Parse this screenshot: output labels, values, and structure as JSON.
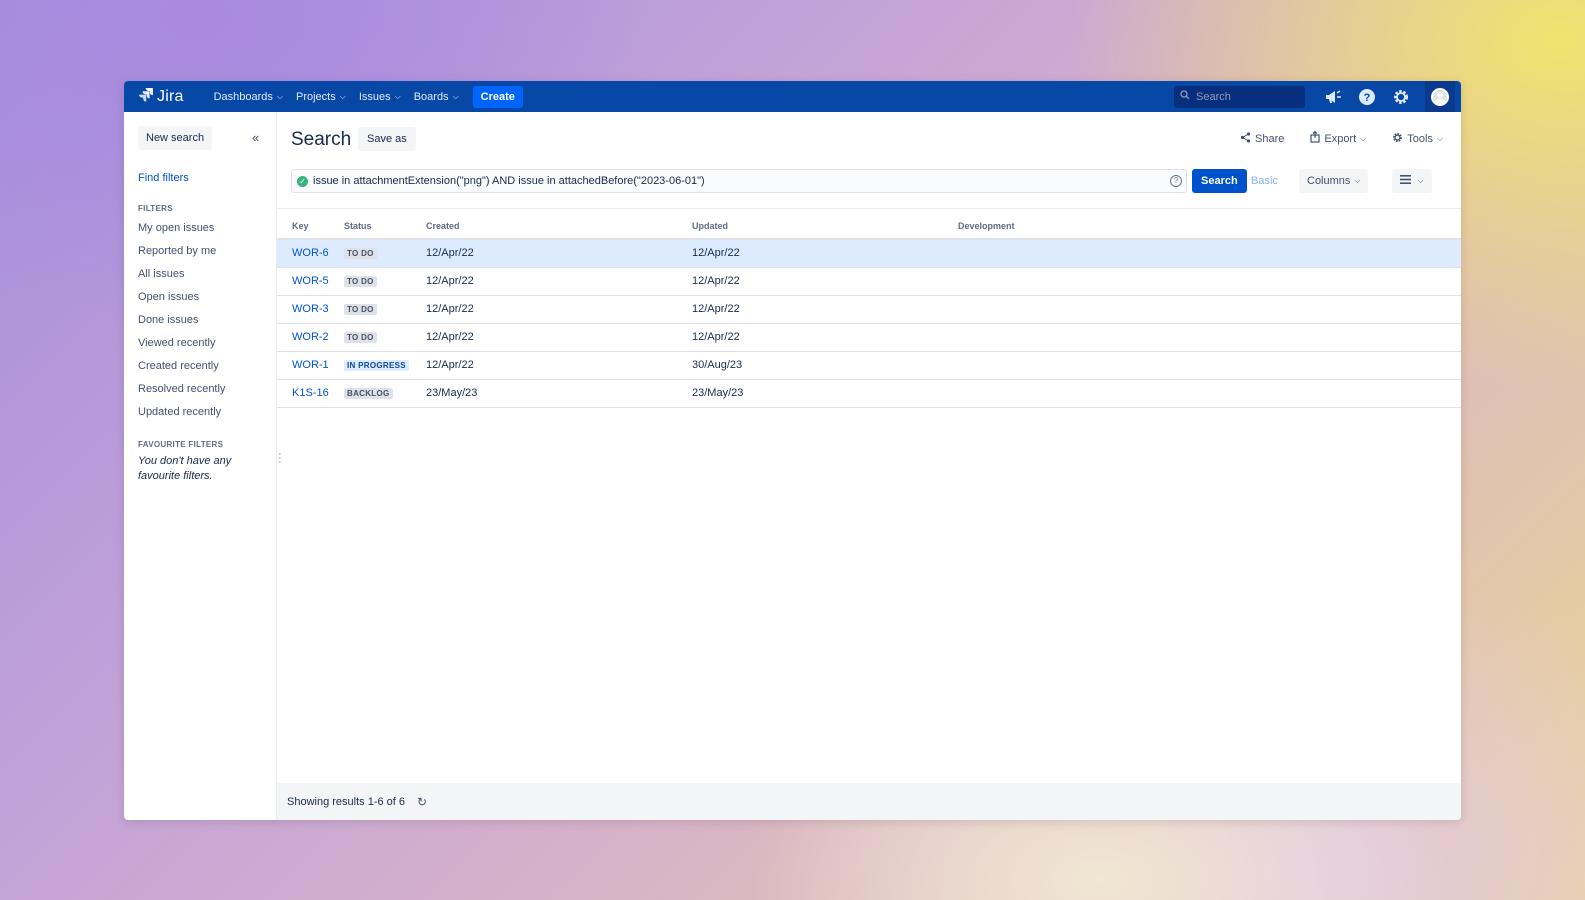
{
  "nav": {
    "logo": "Jira",
    "items": [
      {
        "label": "Dashboards"
      },
      {
        "label": "Projects"
      },
      {
        "label": "Issues"
      },
      {
        "label": "Boards"
      }
    ],
    "create_label": "Create",
    "search_placeholder": "Search"
  },
  "sidebar": {
    "new_search": "New search",
    "find_filters": "Find filters",
    "filters_title": "FILTERS",
    "filters": [
      "My open issues",
      "Reported by me",
      "All issues",
      "Open issues",
      "Done issues",
      "Viewed recently",
      "Created recently",
      "Resolved recently",
      "Updated recently"
    ],
    "favourite_title": "FAVOURITE FILTERS",
    "favourite_empty": "You don't have any favourite filters."
  },
  "header": {
    "title": "Search",
    "save_as": "Save as",
    "share": "Share",
    "export": "Export",
    "tools": "Tools"
  },
  "query": {
    "jql": "issue in attachmentExtension(\"png\") AND issue in attachedBefore(\"2023-06-01\")",
    "search_button": "Search",
    "basic_link": "Basic",
    "columns_button": "Columns"
  },
  "table": {
    "columns": [
      "Key",
      "Status",
      "Created",
      "Updated",
      "Development"
    ],
    "rows": [
      {
        "key": "WOR-6",
        "status": "TO DO",
        "created": "12/Apr/22",
        "updated": "12/Apr/22"
      },
      {
        "key": "WOR-5",
        "status": "TO DO",
        "created": "12/Apr/22",
        "updated": "12/Apr/22"
      },
      {
        "key": "WOR-3",
        "status": "TO DO",
        "created": "12/Apr/22",
        "updated": "12/Apr/22"
      },
      {
        "key": "WOR-2",
        "status": "TO DO",
        "created": "12/Apr/22",
        "updated": "12/Apr/22"
      },
      {
        "key": "WOR-1",
        "status": "IN PROGRESS",
        "created": "12/Apr/22",
        "updated": "30/Aug/23"
      },
      {
        "key": "K1S-16",
        "status": "BACKLOG",
        "created": "23/May/23",
        "updated": "23/May/23"
      }
    ]
  },
  "footer": {
    "results": "Showing results 1-6 of 6"
  },
  "colors": {
    "nav_bg": "#0747a6",
    "primary": "#0052cc",
    "selected_row": "#deebff"
  }
}
